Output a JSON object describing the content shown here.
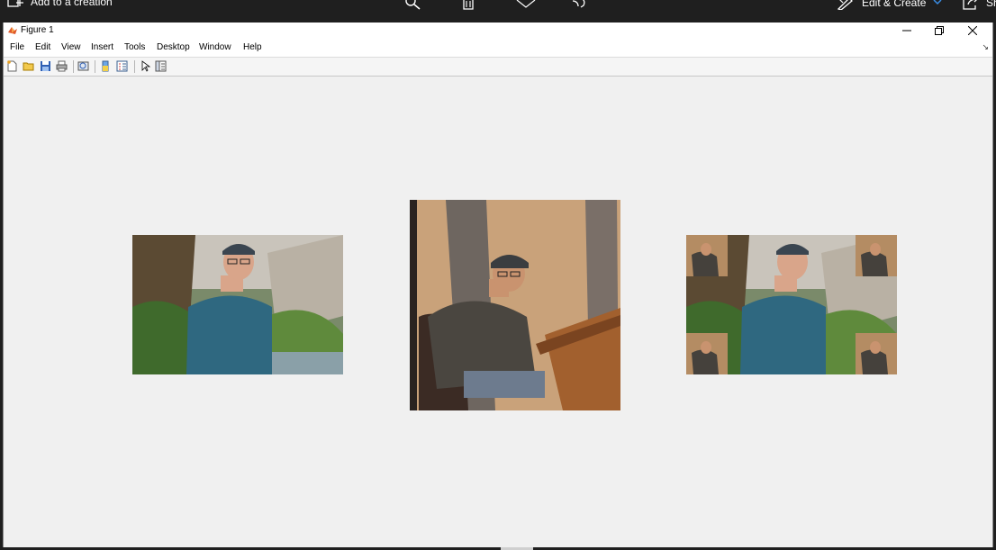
{
  "photos_app": {
    "add_to_creation": "Add to a creation",
    "edit_create": "Edit & Create",
    "share_partial": "Sh"
  },
  "figure": {
    "title": "Figure 1",
    "menus": [
      "File",
      "Edit",
      "View",
      "Insert",
      "Tools",
      "Desktop",
      "Window",
      "Help"
    ],
    "toolbar_icons": [
      "new-figure-icon",
      "open-file-icon",
      "save-icon",
      "print-icon",
      "print-preview-icon",
      "insert-colorbar-icon",
      "insert-legend-icon",
      "edit-plot-pointer-icon",
      "property-inspector-icon"
    ]
  },
  "colors": {
    "photos_bar": "#1f1f1f",
    "figure_bg": "#f0f0f0",
    "titlebar": "#ffffff",
    "accent_chevron": "#3a8ee6"
  }
}
